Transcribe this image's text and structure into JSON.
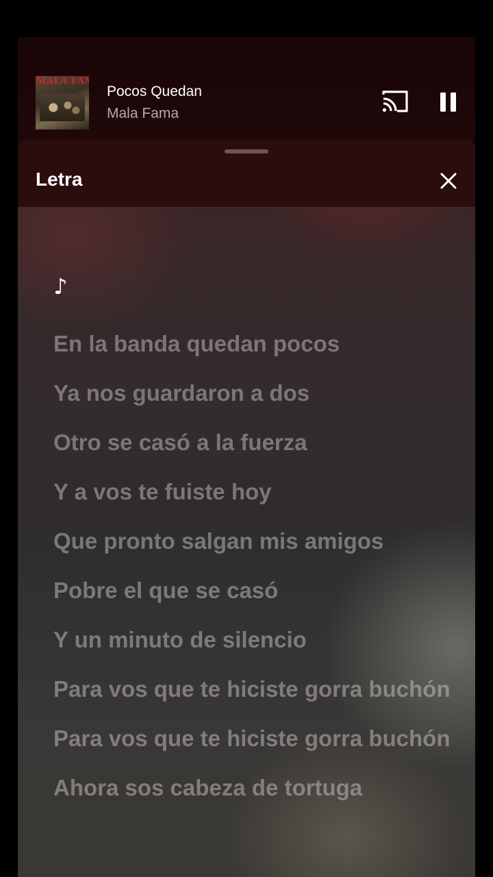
{
  "player": {
    "track_title": "Pocos Quedan",
    "artist": "Mala Fama",
    "album_art_text": "MALA FAMA",
    "icons": {
      "album_art": "album-art-image",
      "cast": "cast-icon",
      "pause": "pause-icon"
    }
  },
  "lyrics_sheet": {
    "title": "Letra",
    "close_icon": "close-icon",
    "current_marker": "♪",
    "lines": [
      "En la banda quedan pocos",
      "Ya nos guardaron a dos",
      "Otro se casó a la fuerza",
      "Y a vos te fuiste hoy",
      "Que pronto salgan mis amigos",
      "Pobre el que se casó",
      "Y un minuto de silencio",
      "Para vos que te hiciste gorra buchón",
      "Para vos que te hiciste gorra buchón",
      "Ahora sos cabeza de tortuga"
    ]
  },
  "colors": {
    "header_bg": "#1c0708",
    "sheet_header_bg": "#2b0d0e",
    "active_text": "#ffffff",
    "inactive_lyric": "#8a8585"
  }
}
